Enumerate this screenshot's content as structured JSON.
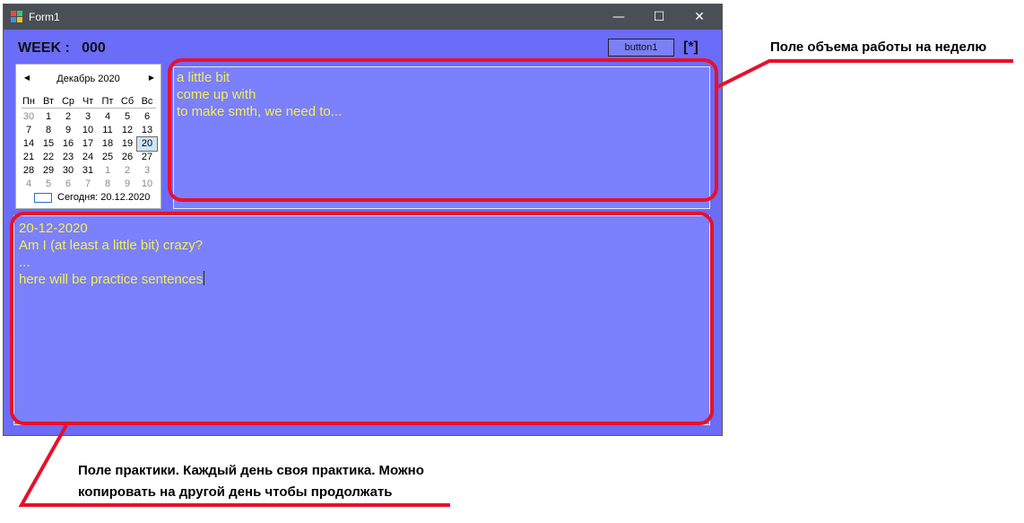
{
  "window": {
    "title": "Form1",
    "controls": {
      "minimize": "—",
      "maximize": "☐",
      "close": "✕"
    }
  },
  "header": {
    "week_label": "WEEK :   000",
    "button1_label": "button1",
    "star_label": "[*]"
  },
  "calendar": {
    "month_title": "Декабрь 2020",
    "prev_arrow": "◀",
    "next_arrow": "▶",
    "day_names": [
      "Пн",
      "Вт",
      "Ср",
      "Чт",
      "Пт",
      "Сб",
      "Вс"
    ],
    "weeks": [
      [
        "30",
        "1",
        "2",
        "3",
        "4",
        "5",
        "6"
      ],
      [
        "7",
        "8",
        "9",
        "10",
        "11",
        "12",
        "13"
      ],
      [
        "14",
        "15",
        "16",
        "17",
        "18",
        "19",
        "20"
      ],
      [
        "21",
        "22",
        "23",
        "24",
        "25",
        "26",
        "27"
      ],
      [
        "28",
        "29",
        "30",
        "31",
        "1",
        "2",
        "3"
      ],
      [
        "4",
        "5",
        "6",
        "7",
        "8",
        "9",
        "10"
      ]
    ],
    "selected_day": "20",
    "today_text": "Сегодня: 20.12.2020"
  },
  "weekly_box": {
    "lines": [
      "a little bit",
      "come up with",
      "to make smth, we need to..."
    ]
  },
  "practice_box": {
    "lines": [
      "20-12-2020",
      "Am I (at least a little bit) crazy?",
      "...",
      "here will be practice sentences"
    ]
  },
  "annotations": {
    "weekly": "Поле объема работы на неделю",
    "practice_line1": "Поле практики. Каждый день своя практика. Можно",
    "practice_line2": "копировать на другой день чтобы продолжать"
  },
  "colors": {
    "form_bg": "#6b6cf8",
    "textbox_bg": "#7b80fc",
    "text_yellow": "#f4f04e",
    "annotation_red": "#e8102a",
    "titlebar": "#4a4e55"
  }
}
